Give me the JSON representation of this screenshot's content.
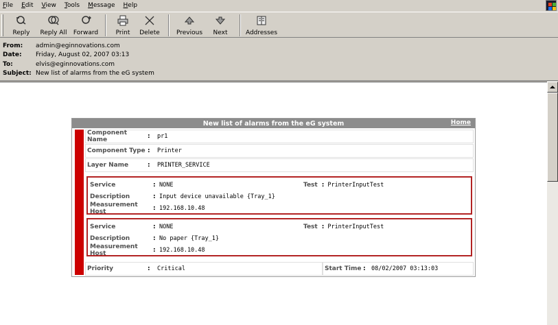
{
  "menu": [
    {
      "label": "File",
      "key": "F",
      "rest": "ile"
    },
    {
      "label": "Edit",
      "key": "E",
      "rest": "dit"
    },
    {
      "label": "View",
      "key": "V",
      "rest": "iew"
    },
    {
      "label": "Tools",
      "key": "T",
      "rest": "ools"
    },
    {
      "label": "Message",
      "key": "M",
      "rest": "essage"
    },
    {
      "label": "Help",
      "key": "H",
      "rest": "elp"
    }
  ],
  "toolbar": {
    "reply": "Reply",
    "reply_all": "Reply All",
    "forward": "Forward",
    "print": "Print",
    "delete": "Delete",
    "previous": "Previous",
    "next": "Next",
    "addresses": "Addresses"
  },
  "headers": {
    "from_label": "From:",
    "from": "admin@eginnovations.com",
    "date_label": "Date:",
    "date": "Friday, August 02, 2007  03:13",
    "to_label": "To:",
    "to": "elvis@eginnovations.com",
    "subject_label": "Subject:",
    "subject": "New list of alarms from the eG system"
  },
  "report": {
    "title": "New list of alarms from the eG system",
    "home_link": "Home",
    "separator": ":",
    "component_name_label": "Component Name",
    "component_name": "pr1",
    "component_type_label": "Component Type",
    "component_type": "Printer",
    "layer_name_label": "Layer Name",
    "layer_name": "PRINTER_SERVICE",
    "alarms": [
      {
        "service_label": "Service",
        "service": "NONE",
        "test_label": "Test",
        "test": "PrinterInputTest",
        "description_label": "Description",
        "description": "Input device unavailable {Tray_1}",
        "host_label": "Measurement Host",
        "host": "192.168.10.48"
      },
      {
        "service_label": "Service",
        "service": "NONE",
        "test_label": "Test",
        "test": "PrinterInputTest",
        "description_label": "Description",
        "description": "No paper {Tray_1}",
        "host_label": "Measurement Host",
        "host": "192.168.10.48"
      }
    ],
    "priority_label": "Priority",
    "priority": "Critical",
    "start_time_label": "Start Time",
    "start_time": "08/02/2007 03:13:03"
  },
  "colors": {
    "alarm_bar": "#cc0000",
    "alarm_border": "#b22222",
    "title_bar": "#8c8c8c"
  }
}
